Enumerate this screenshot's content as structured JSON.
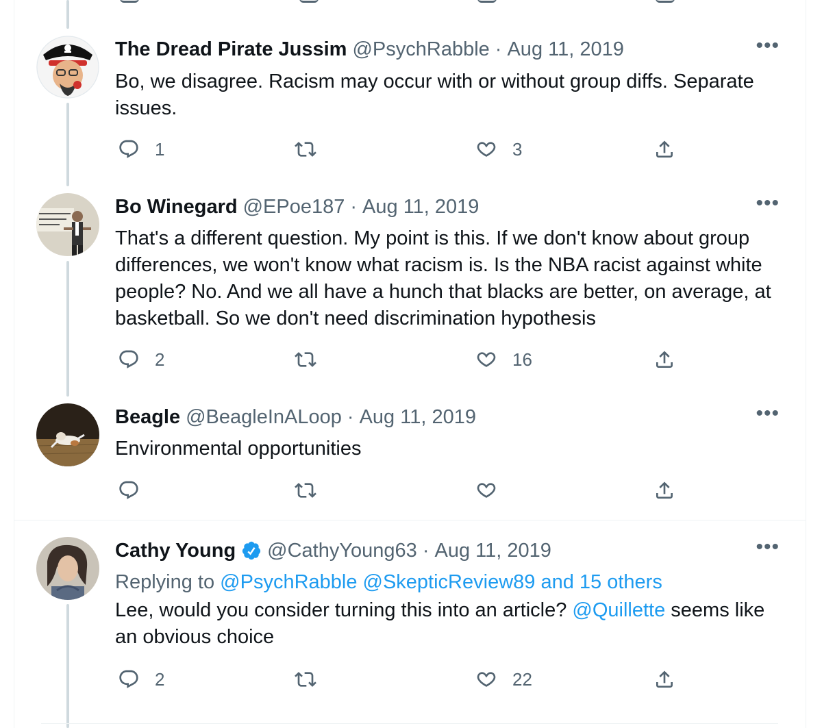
{
  "tweets": [
    {
      "name": "The Dread Pirate Jussim",
      "handle": "@PsychRabble",
      "separator": "·",
      "date": "Aug 11, 2019",
      "more": "•••",
      "verified": false,
      "text_parts": [
        "Bo, we disagree.  Racism may occur with or without group diffs.  Separate issues."
      ],
      "replies": "1",
      "retweets": "",
      "likes": "3"
    },
    {
      "name": "Bo Winegard",
      "handle": "@EPoe187",
      "separator": "·",
      "date": "Aug 11, 2019",
      "more": "•••",
      "verified": false,
      "text_parts": [
        "That's a different question. My point is this. If we don't know about group differences, we won't know what racism is. Is the NBA racist against white people? No. And we all have a hunch that blacks are better, on average, at basketball. So we don't need discrimination hypothesis"
      ],
      "replies": "2",
      "retweets": "",
      "likes": "16"
    },
    {
      "name": "Beagle",
      "handle": "@BeagleInALoop",
      "separator": "·",
      "date": "Aug 11, 2019",
      "more": "•••",
      "verified": false,
      "text_parts": [
        "Environmental opportunities"
      ],
      "replies": "",
      "retweets": "",
      "likes": ""
    },
    {
      "name": "Cathy Young",
      "handle": "@CathyYoung63",
      "separator": "·",
      "date": "Aug 11, 2019",
      "more": "•••",
      "verified": true,
      "replying_label": "Replying to",
      "replying_to": "@PsychRabble @SkepticReview89 and 15 others",
      "text_before": "Lee, would you consider turning this into an article?",
      "mention": "@Quillette",
      "text_after": "seems like an obvious choice",
      "replies": "2",
      "retweets": "",
      "likes": "22"
    }
  ],
  "colors": {
    "text": "#0f1419",
    "secondary": "#536471",
    "link": "#1d9bf0",
    "thread_line": "#cfd9de",
    "divider": "#eff3f4"
  },
  "icons": [
    "reply-icon",
    "retweet-icon",
    "like-icon",
    "share-icon",
    "verified-badge-icon",
    "more-options-icon"
  ]
}
